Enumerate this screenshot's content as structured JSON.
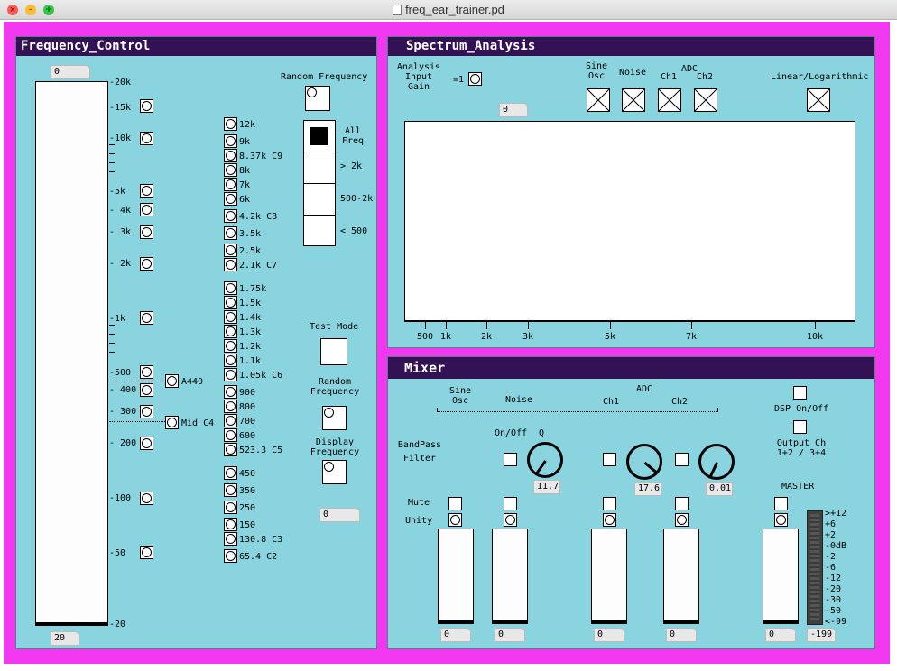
{
  "window": {
    "title": "freq_ear_trainer.pd",
    "close_symbol": "×",
    "minimize_symbol": "–",
    "zoom_symbol": "+"
  },
  "freq": {
    "title": "Frequency_Control",
    "top_number": "0",
    "bottom_number": "20",
    "scale": [
      "-20k",
      "-15k",
      "-10k",
      "-5k",
      "- 4k",
      "- 3k",
      "- 2k",
      "-1k",
      "-500",
      "- 400",
      "- 300",
      "- 200",
      "-100",
      "-50",
      "-20"
    ],
    "side_labels": {
      "a440": "A440",
      "midc4": "Mid C4"
    },
    "buttons": [
      "12k",
      "9k",
      "8.37k C9",
      "8k",
      "7k",
      "6k",
      "4.2k C8",
      "3.5k",
      "2.5k",
      "2.1k C7",
      "1.75k",
      "1.5k",
      "1.4k",
      "1.3k",
      "1.2k",
      "1.1k",
      "1.05k C6",
      "900",
      "800",
      "700",
      "600",
      "523.3 C5",
      "450",
      "350",
      "250",
      "150",
      "130.8 C3",
      "65.4 C2"
    ],
    "random_frequency": "Random Frequency",
    "radio": [
      "All\nFreq",
      "> 2k",
      "500-2k",
      "< 500"
    ],
    "test_mode": "Test Mode",
    "random_frequency2": "Random\nFrequency",
    "display_frequency": "Display\nFrequency",
    "display_number": "0"
  },
  "spectrum": {
    "title": "Spectrum_Analysis",
    "input_gain_label": "Analysis\nInput\nGain",
    "eq1": "=1",
    "gain_number": "0",
    "sources": [
      "Sine\nOsc",
      "Noise",
      "Ch1",
      "Ch2"
    ],
    "adc": "ADC",
    "scale_label": "Linear/Logarithmic",
    "xticks": [
      "500",
      "1k",
      "2k",
      "3k",
      "5k",
      "7k",
      "10k"
    ]
  },
  "mixer": {
    "title": "Mixer",
    "top_labels": {
      "sine": "Sine\nOsc",
      "noise": "Noise",
      "adc": "ADC",
      "ch1": "Ch1",
      "ch2": "Ch2"
    },
    "dsp": "DSP On/Off",
    "output_ch": "Output Ch\n1+2 / 3+4",
    "bandpass": "BandPass\nFilter",
    "onoff": "On/Off",
    "q": "Q",
    "knob_values": [
      "11.7",
      "17.6",
      "0.01"
    ],
    "mute": "Mute",
    "unity": "Unity",
    "master": "MASTER",
    "fader_values": [
      "0",
      "0",
      "0",
      "0",
      "0"
    ],
    "vu_scale": [
      ">+12",
      "+6",
      "+2",
      "-0dB",
      "-2",
      "-6",
      "-12",
      "-20",
      "-30",
      "-50",
      "<-99"
    ],
    "vu_value": "-199"
  }
}
